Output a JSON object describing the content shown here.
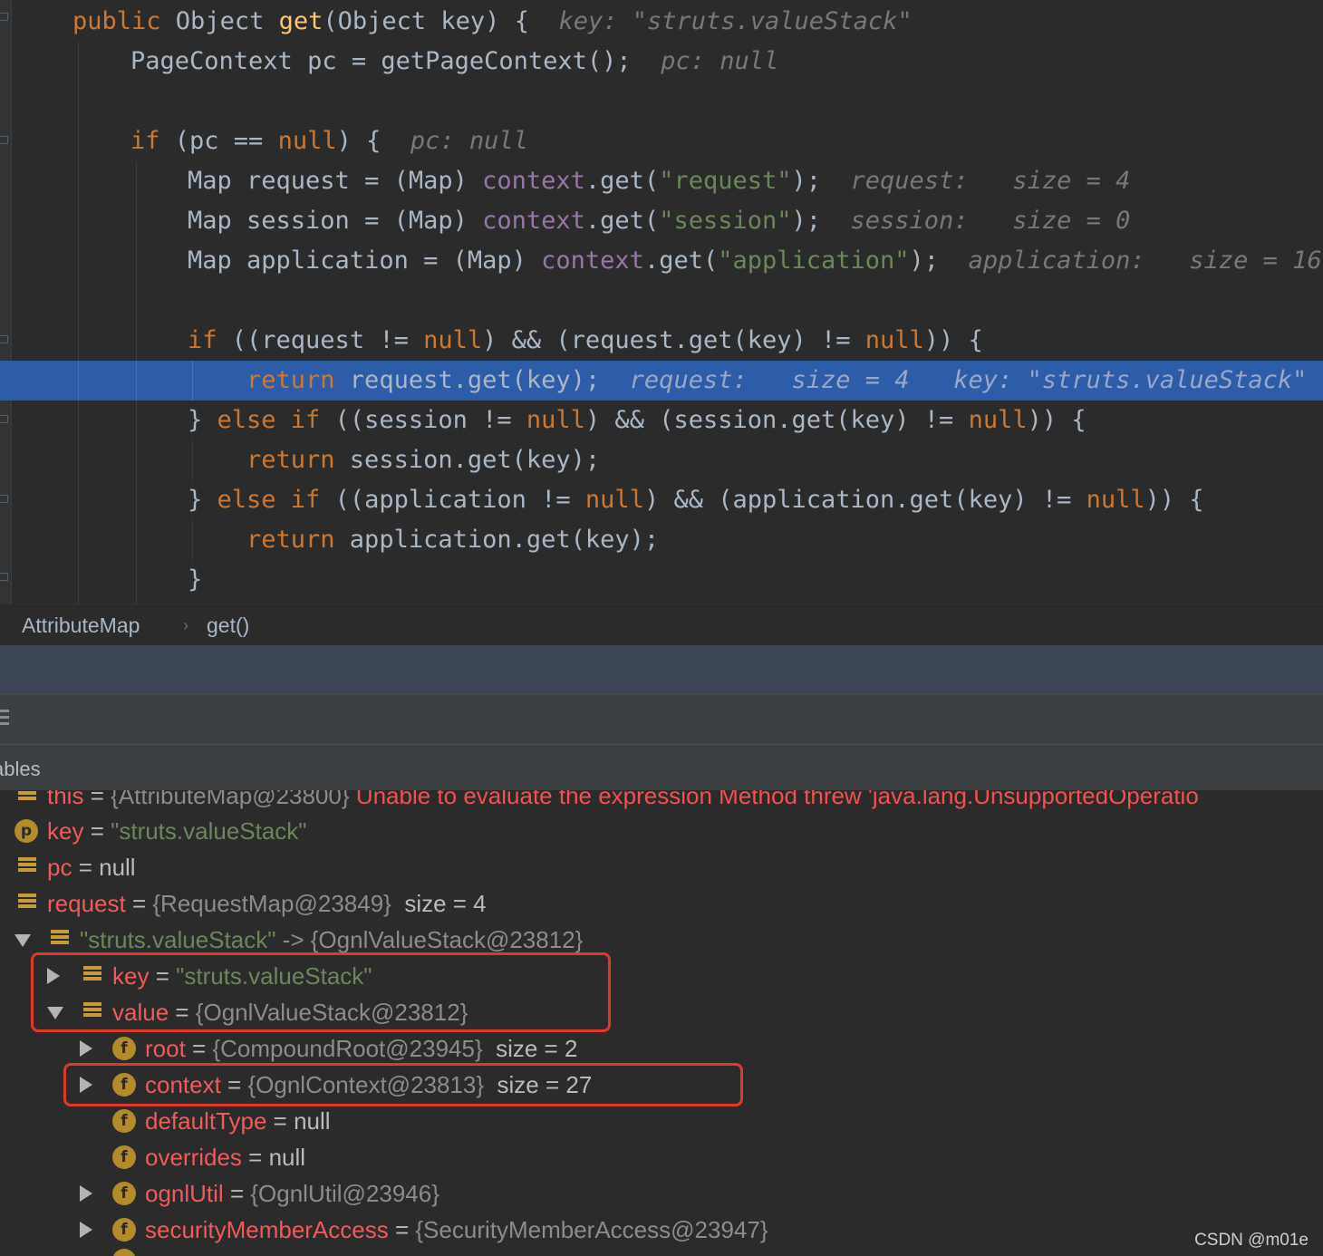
{
  "editor": {
    "lines": {
      "l1": {
        "kw": "public",
        "pre": " Object ",
        "fn": "get",
        "rest": "(Object key) {",
        "hint": "key: \"struts.valueStack\""
      },
      "l2": {
        "code": "PageContext pc = getPageContext();",
        "hint": "pc: null"
      },
      "l4": {
        "kw": "if",
        "rest": " (pc == ",
        "kw2": "null",
        "rest2": ") {",
        "hint": "pc: null"
      },
      "l5": {
        "a": "Map request = (Map) ",
        "fld": "context",
        "b": ".get(",
        "str": "\"request\"",
        "c": ");",
        "hint": "request:   size = 4"
      },
      "l6": {
        "a": "Map session = (Map) ",
        "fld": "context",
        "b": ".get(",
        "str": "\"session\"",
        "c": ");",
        "hint": "session:   size = 0"
      },
      "l7": {
        "a": "Map application = (Map) ",
        "fld": "context",
        "b": ".get(",
        "str": "\"application\"",
        "c": ");",
        "hint": "application:   size = 16"
      },
      "l9": {
        "kw": "if",
        "a": " ((request != ",
        "kw2": "null",
        "b": ") && (request.get(key) != ",
        "kw3": "null",
        "c": ")) {"
      },
      "l10": {
        "kw": "return",
        "a": " request.get(key);",
        "hint": "request:   size = 4   key: \"struts.valueStack\""
      },
      "l11": {
        "a": "} ",
        "kw": "else if",
        "b": " ((session != ",
        "kw2": "null",
        "c": ") && (session.get(key) != ",
        "kw3": "null",
        "d": ")) {"
      },
      "l12": {
        "kw": "return",
        "a": " session.get(key);"
      },
      "l13": {
        "a": "} ",
        "kw": "else if",
        "b": " ((application != ",
        "kw2": "null",
        "c": ") && (application.get(key) != ",
        "kw3": "null",
        "d": ")) {"
      },
      "l14": {
        "kw": "return",
        "a": " application.get(key);"
      },
      "l15": {
        "a": "}"
      }
    }
  },
  "breadcrumb": {
    "class_name": "AttributeMap",
    "method": "get()"
  },
  "variables_header": "ables",
  "variables": {
    "this_row": {
      "name": "this",
      "value": "{AttributeMap@23800}",
      "error": "Unable to evaluate the expression Method threw 'java.lang.UnsupportedOperatio"
    },
    "key_row": {
      "badge": "p",
      "name": "key",
      "value": "\"struts.valueStack\""
    },
    "pc_row": {
      "name": "pc",
      "value": "null"
    },
    "request_row": {
      "name": "request",
      "value": "{RequestMap@23849}",
      "extra": "size = 4"
    },
    "entry_row": {
      "key": "\"struts.valueStack\"",
      "arrow": "->",
      "value": "{OgnlValueStack@23812}"
    },
    "entry_key_row": {
      "name": "key",
      "value": "\"struts.valueStack\""
    },
    "entry_value_row": {
      "name": "value",
      "value": "{OgnlValueStack@23812}"
    },
    "root_row": {
      "badge": "f",
      "name": "root",
      "value": "{CompoundRoot@23945}",
      "extra": "size = 2"
    },
    "context_row": {
      "badge": "f",
      "name": "context",
      "value": "{OgnlContext@23813}",
      "extra": "size = 27"
    },
    "defaulttype_row": {
      "badge": "f",
      "name": "defaultType",
      "value": "null"
    },
    "overrides_row": {
      "badge": "f",
      "name": "overrides",
      "value": "null"
    },
    "ognlutil_row": {
      "badge": "f",
      "name": "ognlUtil",
      "value": "{OgnlUtil@23946}"
    },
    "sma_row": {
      "badge": "f",
      "name": "securityMemberAccess",
      "value": "{SecurityMemberAccess@23947}"
    }
  },
  "watermark": "CSDN @m01e",
  "colors": {
    "highlight": "#2d5ca8",
    "annotation_box": "#e0392b",
    "keyword": "#cc7832",
    "string": "#6a8759"
  }
}
